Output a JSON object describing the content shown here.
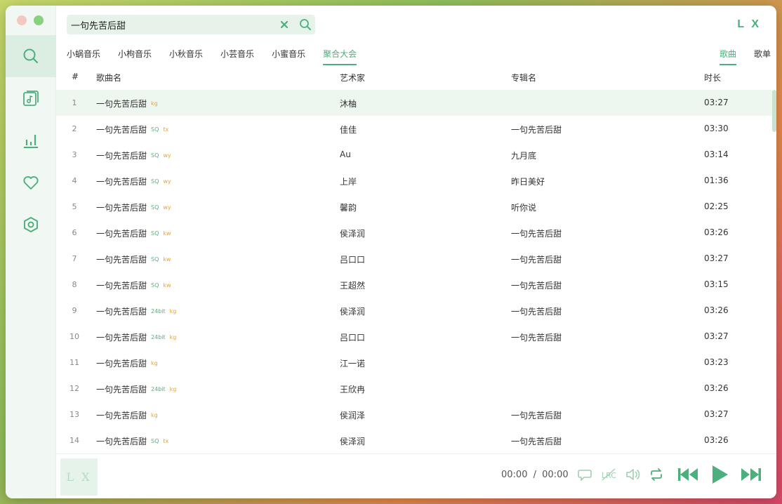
{
  "search": {
    "value": "一句先苦后甜"
  },
  "logo": "L X",
  "sources": [
    "小蜗音乐",
    "小枸音乐",
    "小秋音乐",
    "小芸音乐",
    "小蜜音乐",
    "聚合大会"
  ],
  "active_source_index": 5,
  "types": [
    "歌曲",
    "歌单"
  ],
  "active_type_index": 0,
  "table": {
    "headers": {
      "num": "#",
      "name": "歌曲名",
      "artist": "艺术家",
      "album": "专辑名",
      "duration": "时长"
    },
    "rows": [
      {
        "num": "1",
        "name": "一句先苦后甜",
        "quality": "",
        "source": "kg",
        "artist": "沐柚",
        "album": "",
        "duration": "03:27"
      },
      {
        "num": "2",
        "name": "一句先苦后甜",
        "quality": "SQ",
        "source": "tx",
        "artist": "佳佳",
        "album": "一句先苦后甜",
        "duration": "03:30"
      },
      {
        "num": "3",
        "name": "一句先苦后甜",
        "quality": "SQ",
        "source": "wy",
        "artist": "Au",
        "album": "九月底",
        "duration": "03:14"
      },
      {
        "num": "4",
        "name": "一句先苦后甜",
        "quality": "SQ",
        "source": "wy",
        "artist": "上岸",
        "album": "昨日美好",
        "duration": "01:36"
      },
      {
        "num": "5",
        "name": "一句先苦后甜",
        "quality": "SQ",
        "source": "wy",
        "artist": "馨韵",
        "album": "听你说",
        "duration": "02:25"
      },
      {
        "num": "6",
        "name": "一句先苦后甜",
        "quality": "SQ",
        "source": "kw",
        "artist": "侯泽润",
        "album": "一句先苦后甜",
        "duration": "03:26"
      },
      {
        "num": "7",
        "name": "一句先苦后甜",
        "quality": "SQ",
        "source": "kw",
        "artist": "吕口口",
        "album": "一句先苦后甜",
        "duration": "03:27"
      },
      {
        "num": "8",
        "name": "一句先苦后甜",
        "quality": "SQ",
        "source": "kw",
        "artist": "王超然",
        "album": "一句先苦后甜",
        "duration": "03:15"
      },
      {
        "num": "9",
        "name": "一句先苦后甜",
        "quality": "24bit",
        "source": "kg",
        "artist": "侯泽润",
        "album": "一句先苦后甜",
        "duration": "03:26"
      },
      {
        "num": "10",
        "name": "一句先苦后甜",
        "quality": "24bit",
        "source": "kg",
        "artist": "吕口口",
        "album": "一句先苦后甜",
        "duration": "03:27"
      },
      {
        "num": "11",
        "name": "一句先苦后甜",
        "quality": "",
        "source": "kg",
        "artist": "江一诺",
        "album": "",
        "duration": "03:23"
      },
      {
        "num": "12",
        "name": "一句先苦后甜",
        "quality": "24bit",
        "source": "kg",
        "artist": "王欣冉",
        "album": "",
        "duration": "03:26"
      },
      {
        "num": "13",
        "name": "一句先苦后甜",
        "quality": "",
        "source": "kg",
        "artist": "侯润泽",
        "album": "一句先苦后甜",
        "duration": "03:27"
      },
      {
        "num": "14",
        "name": "一句先苦后甜",
        "quality": "SQ",
        "source": "tx",
        "artist": "侯泽润",
        "album": "一句先苦后甜",
        "duration": "03:26"
      }
    ]
  },
  "player": {
    "cover_text": "L X",
    "current_time": "00:00",
    "separator": "/",
    "total_time": "00:00"
  },
  "colors": {
    "accent": "#4daf7c",
    "sidebar_bg": "#f1f8f3",
    "selected_row": "#edf7f0",
    "source_badge": "#e6a33c"
  }
}
